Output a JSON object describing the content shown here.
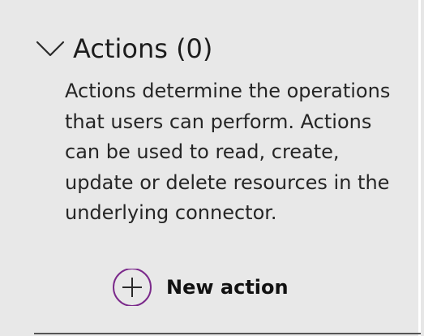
{
  "section": {
    "title": "Actions (0)",
    "expanded": true,
    "toggle_icon": "chevron-down-icon",
    "description": "Actions determine the operations that users can perform. Actions can be used to read, create, update or delete resources in the underlying connector."
  },
  "new_action": {
    "label": "New action",
    "icon": "plus-circle-icon",
    "accent_color": "#7b2a8b"
  }
}
